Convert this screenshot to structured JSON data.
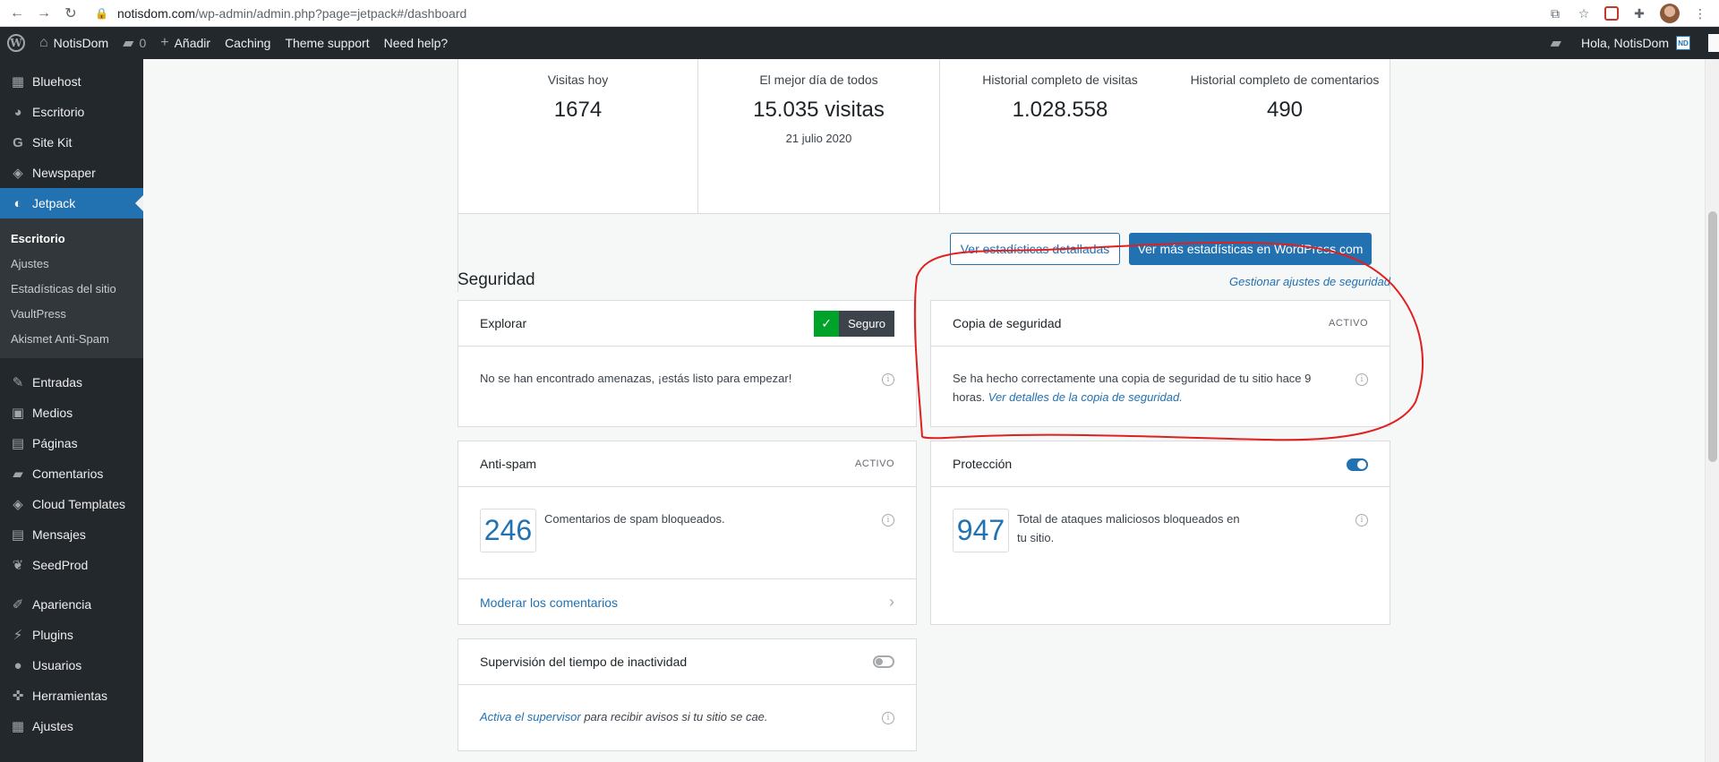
{
  "browser": {
    "url_host": "notisdom.com",
    "url_path": "/wp-admin/admin.php?page=jetpack#/dashboard"
  },
  "adminbar": {
    "site_name": "NotisDom",
    "comments_count": "0",
    "add_new": "Añadir",
    "caching": "Caching",
    "theme_support": "Theme support",
    "need_help": "Need help?",
    "greeting": "Hola, NotisDom",
    "avatar_badge": "ND"
  },
  "sidebar": {
    "top_items": [
      {
        "label": "Bluehost",
        "icon": "grid-icon"
      },
      {
        "label": "Escritorio",
        "icon": "dashboard-icon"
      },
      {
        "label": "Site Kit",
        "icon": "google-icon"
      },
      {
        "label": "Newspaper",
        "icon": "newspaper-icon"
      },
      {
        "label": "Jetpack",
        "icon": "jetpack-icon"
      }
    ],
    "jetpack_sub": [
      "Escritorio",
      "Ajustes",
      "Estadísticas del sitio",
      "VaultPress",
      "Akismet Anti-Spam"
    ],
    "content_items": [
      {
        "label": "Entradas",
        "icon": "pin-icon"
      },
      {
        "label": "Medios",
        "icon": "media-icon"
      },
      {
        "label": "Páginas",
        "icon": "pages-icon"
      },
      {
        "label": "Comentarios",
        "icon": "comments-icon"
      },
      {
        "label": "Cloud Templates",
        "icon": "templates-icon"
      },
      {
        "label": "Mensajes",
        "icon": "messages-icon"
      },
      {
        "label": "SeedProd",
        "icon": "seedprod-icon"
      }
    ],
    "admin_items": [
      {
        "label": "Apariencia",
        "icon": "brush-icon"
      },
      {
        "label": "Plugins",
        "icon": "plugin-icon"
      },
      {
        "label": "Usuarios",
        "icon": "user-icon"
      },
      {
        "label": "Herramientas",
        "icon": "wrench-icon"
      },
      {
        "label": "Ajustes",
        "icon": "settings-icon"
      }
    ]
  },
  "stats": {
    "today_label": "Visitas hoy",
    "today_value": "1674",
    "best_label": "El mejor día de todos",
    "best_value": "15.035 visitas",
    "best_date": "21 julio 2020",
    "total_visits_label": "Historial completo de visitas",
    "total_visits_value": "1.028.558",
    "total_comments_label": "Historial completo de comentarios",
    "total_comments_value": "490",
    "btn_detailed": "Ver estadísticas detalladas",
    "btn_wpcom": "Ver más estadísticas en WordPress.com"
  },
  "security": {
    "title": "Seguridad",
    "manage_link": "Gestionar ajustes de seguridad",
    "scan": {
      "title": "Explorar",
      "badge": "Seguro",
      "message": "No se han encontrado amenazas, ¡estás listo para empezar!"
    },
    "backup": {
      "title": "Copia de seguridad",
      "status": "ACTIVO",
      "message_line1": "Se ha hecho correctamente una copia de seguridad de tu sitio hace 9",
      "message_line2": "horas.",
      "link": "Ver detalles de la copia de seguridad."
    },
    "antispam": {
      "title": "Anti-spam",
      "status": "ACTIVO",
      "count": "246",
      "message": "Comentarios de spam bloqueados.",
      "footer_link": "Moderar los comentarios"
    },
    "protect": {
      "title": "Protección",
      "count": "947",
      "message_line1": "Total de ataques maliciosos bloqueados en",
      "message_line2": "tu sitio."
    },
    "monitor": {
      "title": "Supervisión del tiempo de inactividad",
      "link": "Activa el supervisor",
      "message": " para recibir avisos si tu sitio se cae."
    }
  }
}
